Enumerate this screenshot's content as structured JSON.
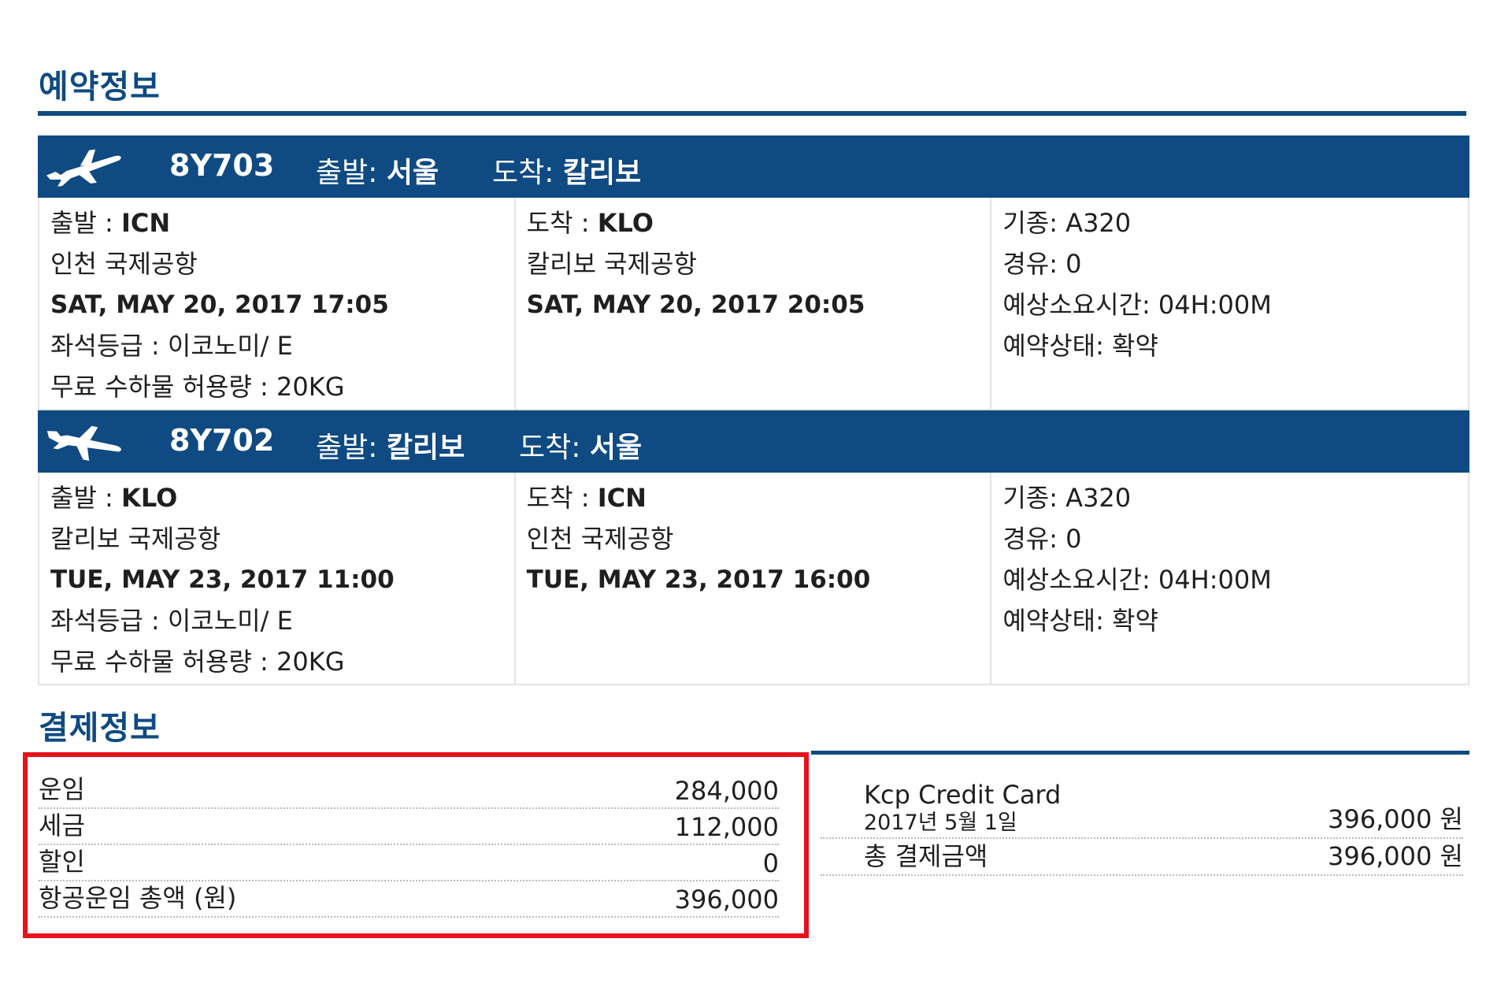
{
  "reservation": {
    "title": "예약정보",
    "flights": [
      {
        "flight_no": "8Y703",
        "bar_dep_label": "출발:",
        "bar_dep_city": "서울",
        "bar_arr_label": "도착:",
        "bar_arr_city": "칼리보",
        "dep_label": "출발 : ",
        "dep_code": "ICN",
        "dep_airport": "인천 국제공항",
        "dep_datetime": "SAT, MAY 20, 2017 17:05",
        "seat_class": "좌석등급 : 이코노미/ E",
        "baggage": "무료 수하물 허용량 : 20KG",
        "arr_label": "도착 : ",
        "arr_code": "KLO",
        "arr_airport": "칼리보 국제공항",
        "arr_datetime": "SAT, MAY 20, 2017 20:05",
        "aircraft": "기종: A320",
        "stops": "경유: 0",
        "duration": "예상소요시간: 04H:00M",
        "status": "예약상태: 확약"
      },
      {
        "flight_no": "8Y702",
        "bar_dep_label": "출발:",
        "bar_dep_city": "칼리보",
        "bar_arr_label": "도착:",
        "bar_arr_city": "서울",
        "dep_label": "출발 : ",
        "dep_code": "KLO",
        "dep_airport": "칼리보 국제공항",
        "dep_datetime": "TUE, MAY 23, 2017 11:00",
        "seat_class": "좌석등급 : 이코노미/ E",
        "baggage": "무료 수하물 허용량 : 20KG",
        "arr_label": "도착 : ",
        "arr_code": "ICN",
        "arr_airport": "인천 국제공항",
        "arr_datetime": "TUE, MAY 23, 2017 16:00",
        "aircraft": "기종: A320",
        "stops": "경유: 0",
        "duration": "예상소요시간: 04H:00M",
        "status": "예약상태: 확약"
      }
    ]
  },
  "payment": {
    "title": "결제정보",
    "fare_rows": [
      {
        "label": "운임",
        "value": "284,000"
      },
      {
        "label": "세금",
        "value": "112,000"
      },
      {
        "label": "할인",
        "value": "0"
      },
      {
        "label": "항공운임 총액 (원)",
        "value": "396,000"
      }
    ],
    "method": "Kcp Credit Card",
    "date": "2017년 5월 1일",
    "date_amount": "396,000 원",
    "total_label": "총 결제금액",
    "total_amount": "396,000 원"
  },
  "colors": {
    "brand": "#0f4a82",
    "highlight": "#e8121c"
  }
}
